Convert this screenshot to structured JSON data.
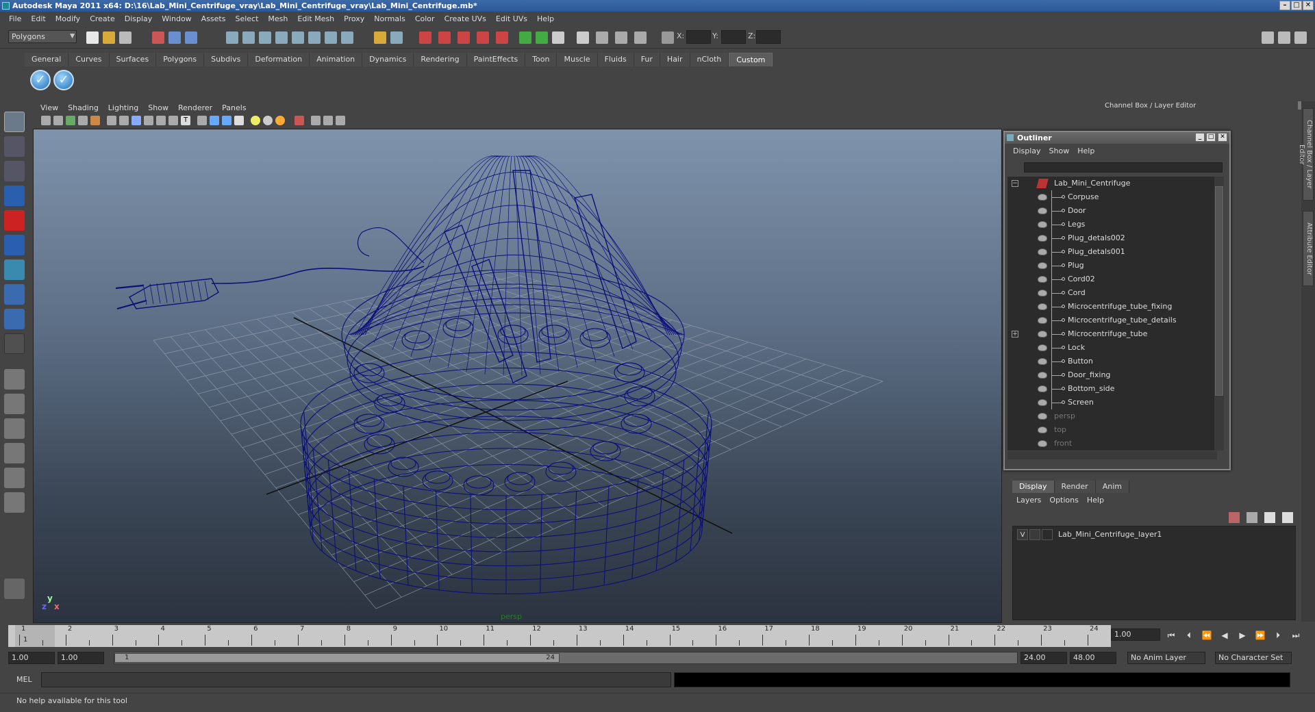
{
  "window": {
    "title": "Autodesk Maya 2011 x64: D:\\16\\Lab_Mini_Centrifuge_vray\\Lab_Mini_Centrifuge_vray\\Lab_Mini_Centrifuge.mb*",
    "controls": [
      "minimize-icon",
      "maximize-icon",
      "close-icon"
    ]
  },
  "menubar": [
    "File",
    "Edit",
    "Modify",
    "Create",
    "Display",
    "Window",
    "Assets",
    "Select",
    "Mesh",
    "Edit Mesh",
    "Proxy",
    "Normals",
    "Color",
    "Create UVs",
    "Edit UVs",
    "Help"
  ],
  "statusline": {
    "menuset": "Polygons",
    "x_label": "X:",
    "y_label": "Y:",
    "z_label": "Z:"
  },
  "shelf": {
    "tabs": [
      "General",
      "Curves",
      "Surfaces",
      "Polygons",
      "Subdivs",
      "Deformation",
      "Animation",
      "Dynamics",
      "Rendering",
      "PaintEffects",
      "Toon",
      "Muscle",
      "Fluids",
      "Fur",
      "Hair",
      "nCloth",
      "Custom"
    ],
    "active_tab": "Custom",
    "buttons": [
      "check-icon",
      "check-icon"
    ]
  },
  "viewport": {
    "menus": [
      "View",
      "Shading",
      "Lighting",
      "Show",
      "Renderer",
      "Panels"
    ],
    "camera": "persp",
    "axis_labels": {
      "y": "y",
      "x": "x",
      "z": "z"
    }
  },
  "right_panel": {
    "header": "Channel Box / Layer Editor",
    "side_tabs": [
      "Channel Box / Layer Editor",
      "Attribute Editor"
    ]
  },
  "outliner": {
    "title": "Outliner",
    "menus": [
      "Display",
      "Show",
      "Help"
    ],
    "root": "Lab_Mini_Centrifuge",
    "children": [
      "Corpuse",
      "Door",
      "Legs",
      "Plug_detals002",
      "Plug_detals001",
      "Plug",
      "Cord02",
      "Cord",
      "Microcentrifuge_tube_fixing",
      "Microcentrifuge_tube_details",
      "Microcentrifuge_tube",
      "Lock",
      "Button",
      "Door_fixing",
      "Bottom_side",
      "Screen"
    ],
    "cameras": [
      "persp",
      "top",
      "front"
    ]
  },
  "layer_editor": {
    "tabs": [
      "Display",
      "Render",
      "Anim"
    ],
    "active_tab": "Display",
    "menus": [
      "Layers",
      "Options",
      "Help"
    ],
    "layer": {
      "visible": "V",
      "name": "Lab_Mini_Centrifuge_layer1"
    }
  },
  "timeline": {
    "ticks": [
      "1",
      "2",
      "3",
      "4",
      "5",
      "6",
      "7",
      "8",
      "9",
      "10",
      "11",
      "12",
      "13",
      "14",
      "15",
      "16",
      "17",
      "18",
      "19",
      "20",
      "21",
      "22",
      "23",
      "24"
    ],
    "current_marker": "1",
    "current_frame": "1.00"
  },
  "range": {
    "start": "1.00",
    "playback_start": "1.00",
    "thumb_start": "1",
    "thumb_end": "24",
    "playback_end": "24.00",
    "end": "48.00",
    "anim_layer": "No Anim Layer",
    "character_set": "No Character Set"
  },
  "command": {
    "label": "MEL"
  },
  "helpline": "No help available for this tool"
}
